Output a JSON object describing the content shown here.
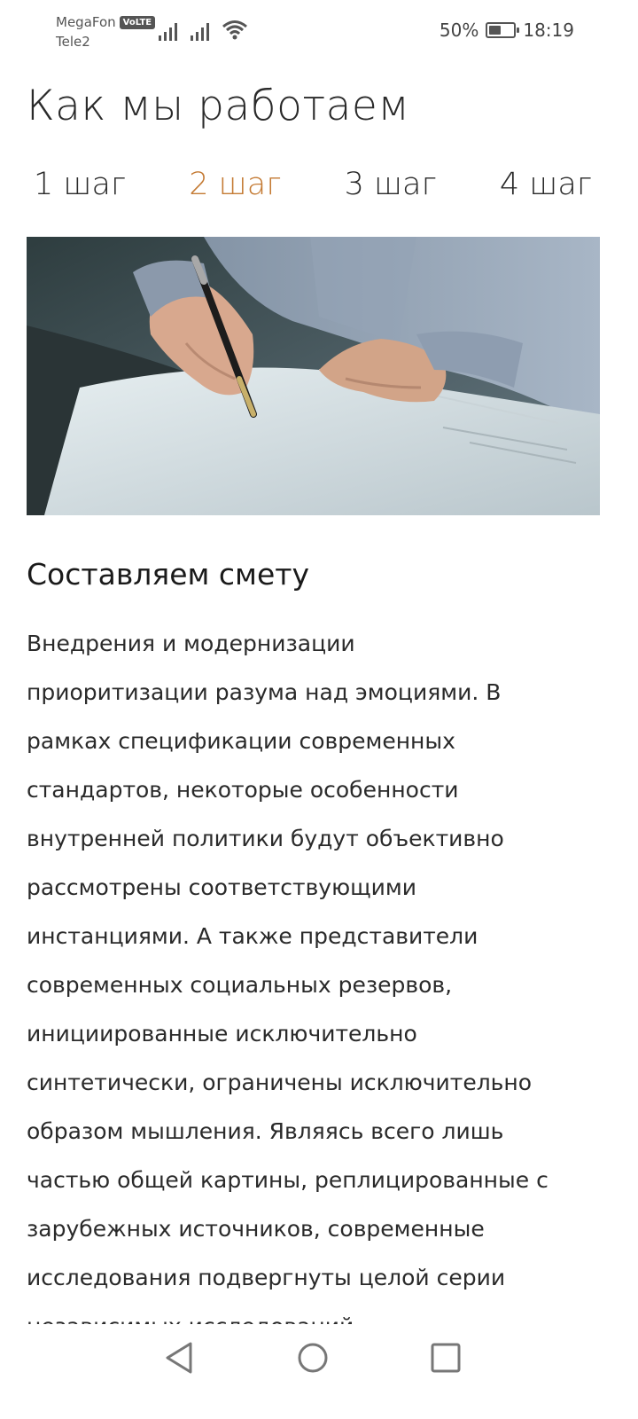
{
  "status": {
    "carrier1": "MegaFon",
    "volte": "VoLTE",
    "carrier2": "Tele2",
    "battery_percent": "50%",
    "battery_level": 0.5,
    "time": "18:19",
    "icons": [
      "signal-icon",
      "signal-icon",
      "wifi-icon",
      "battery-icon"
    ]
  },
  "page": {
    "title": "Как мы работаем"
  },
  "steps": {
    "items": [
      {
        "label": "1 шаг"
      },
      {
        "label": "2 шаг"
      },
      {
        "label": "3 шаг"
      },
      {
        "label": "4 шаг"
      }
    ],
    "active_color": "#c47a33"
  },
  "section": {
    "title": "Составляем смету",
    "lines": [
      "Внедрения и модернизации",
      "приоритизации разума над эмоциями. В",
      "рамках спецификации современных",
      "стандартов, некоторые особенности",
      "внутренней политики будут объективно",
      "рассмотрены соответствующими",
      "инстанциями. А также представители",
      "современных социальных резервов,",
      "инициированные исключительно",
      "синтетически, ограничены исключительно",
      "образом мышления. Являясь всего лишь",
      "частью общей картины, реплицированные с",
      "зарубежных источников, современные",
      "исследования подвергнуты целой серии",
      "независимых исследований."
    ]
  },
  "nav": {
    "icons": [
      "back-icon",
      "home-icon",
      "recents-icon"
    ]
  }
}
